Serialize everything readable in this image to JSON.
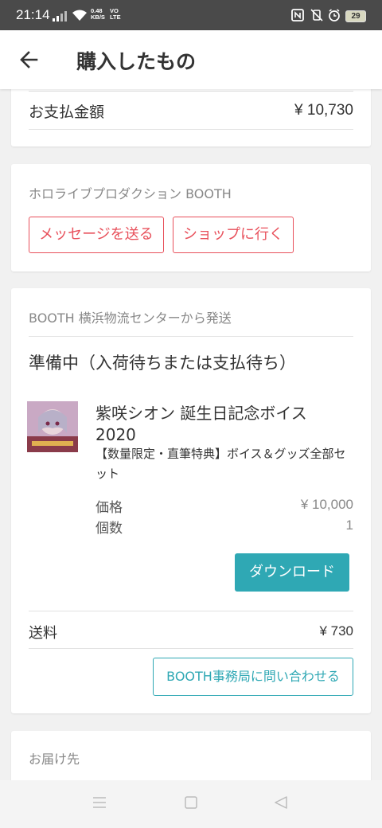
{
  "status_bar": {
    "time": "21:14",
    "speed_value": "0.48",
    "speed_unit": "KB/S",
    "vo": "VO",
    "lte": "LTE",
    "battery": "29"
  },
  "header": {
    "title": "購入したもの"
  },
  "payment": {
    "label": "お支払金額",
    "amount": "¥ 10,730"
  },
  "shop": {
    "name": "ホロライブプロダクション BOOTH",
    "message_button": "メッセージを送る",
    "shop_button": "ショップに行く"
  },
  "shipment": {
    "origin": "BOOTH 横浜物流センターから発送",
    "status": "準備中（入荷待ちまたは支払待ち）",
    "item": {
      "name": "紫咲シオン 誕生日記念ボイス 2020",
      "description": "【数量限定・直筆特典】ボイス＆グッズ全部セット",
      "price_label": "価格",
      "price": "¥ 10,000",
      "qty_label": "個数",
      "qty": "1",
      "download_button": "ダウンロード"
    },
    "shipping_label": "送料",
    "shipping_fee": "¥ 730",
    "contact_button": "BOOTH事務局に問い合わせる"
  },
  "delivery": {
    "label": "お届け先"
  },
  "icons": {
    "back": "arrow-left-icon",
    "nav_menu": "menu-icon",
    "nav_home": "square-icon",
    "nav_back": "triangle-back-icon"
  },
  "colors": {
    "accent_red": "#e8505b",
    "accent_teal": "#2fa8b4",
    "status_bar": "#4a4a4a"
  }
}
